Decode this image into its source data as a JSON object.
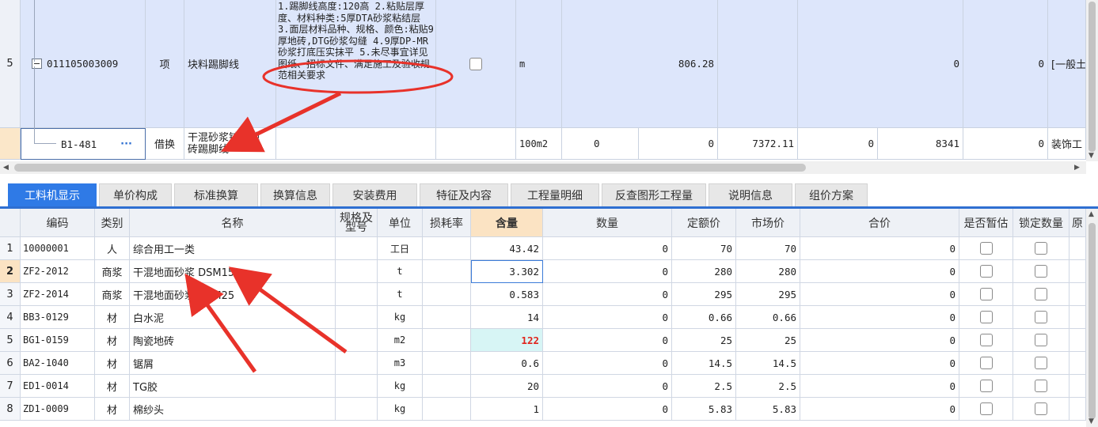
{
  "upper": {
    "row5": {
      "num": "5",
      "code": "011105003009",
      "category": "项",
      "name": "块料踢脚线",
      "description": "1.踢脚线高度:120高\n2.粘贴层厚度、材料种类:5厚DTA砂浆粘结层\n3.面层材料品种、规格、颜色:粘贴9厚地砖,DTG砂浆勾缝\n4.9厚DP-MR砂浆打底压实抹平\n5.未尽事宜详见图纸、招标文件、满足施工及验收规范相关要求",
      "unit": "m",
      "quantity": "806.28",
      "col_a": "0",
      "col_b": "0",
      "specialty": "[一般土"
    },
    "rowB": {
      "code": "B1-481",
      "ellipsis": "···",
      "category": "借换",
      "name": "干混砂浆铺贴地砖踢脚线",
      "unit": "100m2",
      "v1": "0",
      "v2": "0",
      "v3": "7372.11",
      "v4": "0",
      "v5": "8341",
      "v6": "0",
      "specialty": "装饰工"
    }
  },
  "tabs": [
    "工料机显示",
    "单价构成",
    "标准换算",
    "换算信息",
    "安装费用",
    "特征及内容",
    "工程量明细",
    "反查图形工程量",
    "说明信息",
    "组价方案"
  ],
  "lower": {
    "headers": {
      "code": "编码",
      "type": "类别",
      "name": "名称",
      "spec": "规格及型号",
      "unit": "单位",
      "loss": "损耗率",
      "content": "含量",
      "qty": "数量",
      "fixed_price": "定额价",
      "market_price": "市场价",
      "total": "合价",
      "provisional": "是否暂估",
      "locked": "锁定数量",
      "orig": "原"
    },
    "rows": [
      {
        "n": "1",
        "code": "10000001",
        "type": "人",
        "name": "综合用工一类",
        "unit": "工日",
        "content": "43.42",
        "qty": "0",
        "fixed": "70",
        "market": "70",
        "total": "0"
      },
      {
        "n": "2",
        "code": "ZF2-2012",
        "type": "商浆",
        "name": "干混地面砂浆 DSM15",
        "unit": "t",
        "content": "3.302",
        "qty": "0",
        "fixed": "280",
        "market": "280",
        "total": "0"
      },
      {
        "n": "3",
        "code": "ZF2-2014",
        "type": "商浆",
        "name": "干混地面砂浆 DSM25",
        "unit": "t",
        "content": "0.583",
        "qty": "0",
        "fixed": "295",
        "market": "295",
        "total": "0"
      },
      {
        "n": "4",
        "code": "BB3-0129",
        "type": "材",
        "name": "白水泥",
        "unit": "kg",
        "content": "14",
        "qty": "0",
        "fixed": "0.66",
        "market": "0.66",
        "total": "0"
      },
      {
        "n": "5",
        "code": "BG1-0159",
        "type": "材",
        "name": "陶瓷地砖",
        "unit": "m2",
        "content": "122",
        "qty": "0",
        "fixed": "25",
        "market": "25",
        "total": "0"
      },
      {
        "n": "6",
        "code": "BA2-1040",
        "type": "材",
        "name": "锯屑",
        "unit": "m3",
        "content": "0.6",
        "qty": "0",
        "fixed": "14.5",
        "market": "14.5",
        "total": "0"
      },
      {
        "n": "7",
        "code": "ED1-0014",
        "type": "材",
        "name": "TG胶",
        "unit": "kg",
        "content": "20",
        "qty": "0",
        "fixed": "2.5",
        "market": "2.5",
        "total": "0"
      },
      {
        "n": "8",
        "code": "ZD1-0009",
        "type": "材",
        "name": "棉纱头",
        "unit": "kg",
        "content": "1",
        "qty": "0",
        "fixed": "5.83",
        "market": "5.83",
        "total": "0"
      }
    ]
  },
  "colors": {
    "accent": "#2f7ae6",
    "row_highlight": "#dde6fb",
    "annotation": "#e8322a",
    "highlight_value": "#e0241b"
  }
}
